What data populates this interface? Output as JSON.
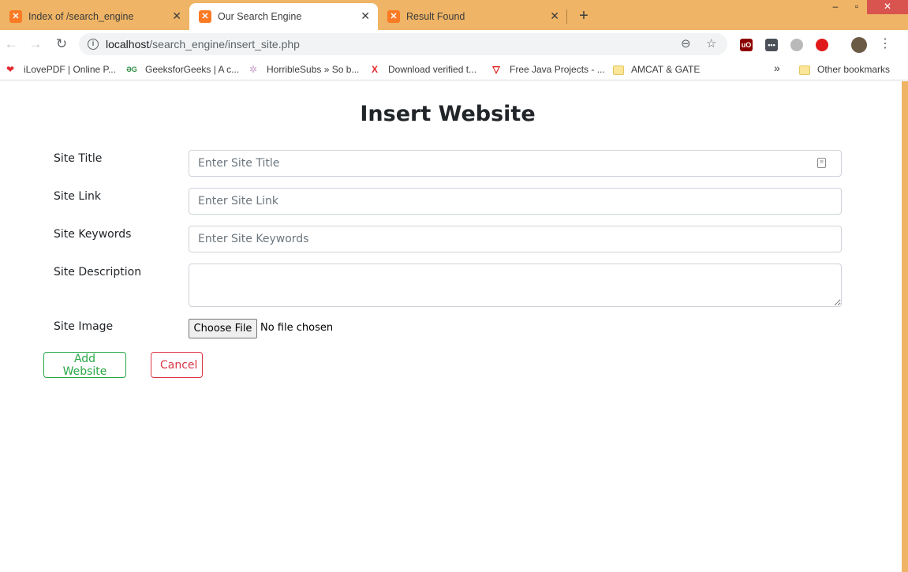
{
  "browser": {
    "tabs": [
      {
        "title": "Index of /search_engine",
        "active": false
      },
      {
        "title": "Our Search Engine",
        "active": true
      },
      {
        "title": "Result Found",
        "active": false
      }
    ],
    "url_host": "localhost",
    "url_path": "/search_engine/insert_site.php",
    "bookmarks": [
      "iLovePDF | Online P...",
      "GeeksforGeeks | A c...",
      "HorribleSubs » So b...",
      "Download verified t...",
      "Free Java Projects - ...",
      "AMCAT & GATE"
    ],
    "bookmarks_overflow": "»",
    "other_bookmarks": "Other bookmarks",
    "colors": {
      "tab_strip": "#efb465",
      "favicon": "#fb7a24"
    }
  },
  "form": {
    "title": "Insert Website",
    "site_title": {
      "label": "Site Title",
      "placeholder": "Enter Site Title",
      "value": ""
    },
    "site_link": {
      "label": "Site Link",
      "placeholder": "Enter Site Link",
      "value": ""
    },
    "site_keywords": {
      "label": "Site Keywords",
      "placeholder": "Enter Site Keywords",
      "value": ""
    },
    "site_description": {
      "label": "Site Description",
      "value": ""
    },
    "site_image": {
      "label": "Site Image",
      "button": "Choose File",
      "status": "No file chosen"
    },
    "add_button": "Add Website",
    "cancel_button": "Cancel",
    "colors": {
      "success": "#28a745",
      "danger": "#dc3545"
    }
  }
}
